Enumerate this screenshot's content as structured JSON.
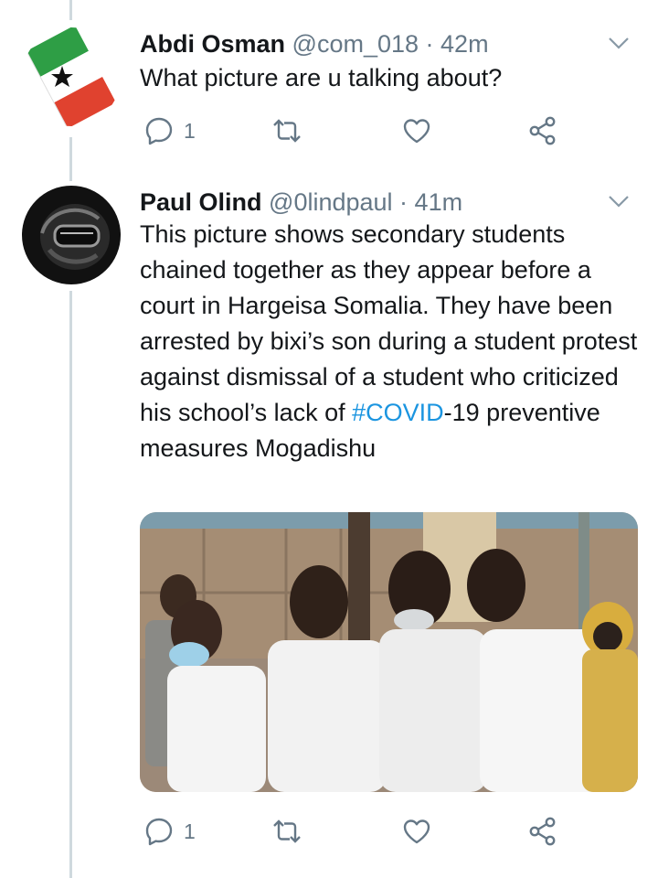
{
  "tweets": [
    {
      "name": "Abdi Osman",
      "handle": "@com_018",
      "sep": " · ",
      "time": "42m",
      "text": "What picture are u talking about?",
      "reply_count": "1",
      "avatar_icon": "flag-avatar"
    },
    {
      "name": "Paul Olind",
      "handle": "@0lindpaul",
      "sep": " · ",
      "time": "41m",
      "text_before": "This picture shows secondary students chained together as they appear before a court in Hargeisa Somalia. They have been arrested by bixi’s son during a student protest against dismissal of a student who criticized his school’s lack of ",
      "hashtag": "#COVID",
      "text_after": "-19 preventive measures Mogadishu",
      "reply_count": "1",
      "avatar_icon": "helmet-avatar"
    }
  ],
  "icons": {
    "reply": "reply-icon",
    "retweet": "retweet-icon",
    "like": "heart-icon",
    "share": "share-icon",
    "more": "chevron-down-icon"
  },
  "colors": {
    "text": "#14171a",
    "muted": "#657786",
    "link": "#1b95e0",
    "thread_line": "#cfd9de"
  }
}
